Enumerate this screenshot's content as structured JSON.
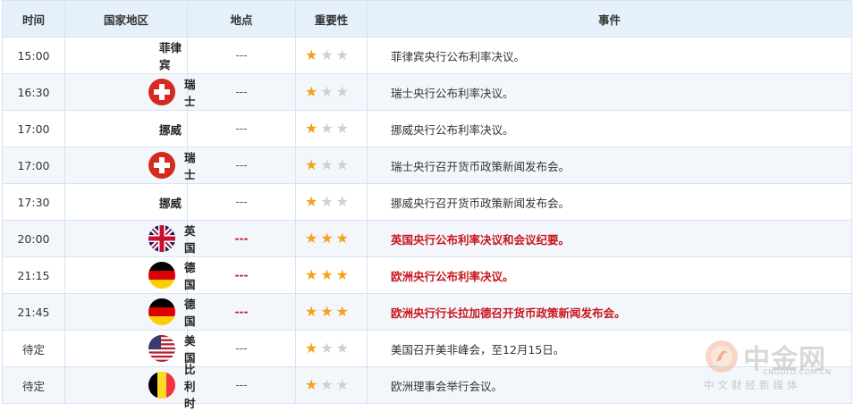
{
  "header": {
    "time": "时间",
    "country": "国家地区",
    "location": "地点",
    "importance": "重要性",
    "event": "事件"
  },
  "rows": [
    {
      "time": "15:00",
      "flag": "none",
      "country": "菲律宾",
      "location": "---",
      "stars": 1,
      "event": "菲律宾央行公布利率决议。",
      "highlight": false
    },
    {
      "time": "16:30",
      "flag": "switzerland",
      "country": "瑞士",
      "location": "---",
      "stars": 1,
      "event": "瑞士央行公布利率决议。",
      "highlight": false
    },
    {
      "time": "17:00",
      "flag": "none",
      "country": "挪威",
      "location": "---",
      "stars": 1,
      "event": "挪威央行公布利率决议。",
      "highlight": false
    },
    {
      "time": "17:00",
      "flag": "switzerland",
      "country": "瑞士",
      "location": "---",
      "stars": 1,
      "event": "瑞士央行召开货币政策新闻发布会。",
      "highlight": false
    },
    {
      "time": "17:30",
      "flag": "none",
      "country": "挪威",
      "location": "---",
      "stars": 1,
      "event": "挪威央行召开货币政策新闻发布会。",
      "highlight": false
    },
    {
      "time": "20:00",
      "flag": "uk",
      "country": "英国",
      "location": "---",
      "stars": 3,
      "event": "英国央行公布利率决议和会议纪要。",
      "highlight": true
    },
    {
      "time": "21:15",
      "flag": "germany",
      "country": "德国",
      "location": "---",
      "stars": 3,
      "event": "欧洲央行公布利率决议。",
      "highlight": true
    },
    {
      "time": "21:45",
      "flag": "germany",
      "country": "德国",
      "location": "---",
      "stars": 3,
      "event": "欧洲央行行长拉加德召开货币政策新闻发布会。",
      "highlight": true
    },
    {
      "time": "待定",
      "flag": "usa",
      "country": "美国",
      "location": "---",
      "stars": 1,
      "event": "美国召开美非峰会，至12月15日。",
      "highlight": false
    },
    {
      "time": "待定",
      "flag": "belgium",
      "country": "比利时",
      "location": "---",
      "stars": 1,
      "event": "欧洲理事会举行会议。",
      "highlight": false
    }
  ],
  "max_stars": 3,
  "colors": {
    "header_bg": "#e6f0fb",
    "border": "#d5e3f2",
    "alt_row": "#f3f7fc",
    "highlight_text": "#c8161d",
    "star_on": "#f4a21a",
    "star_off": "#cfcfcf"
  },
  "watermark": {
    "brand": "中金网",
    "url": "CNGOLD.COM.CN",
    "tagline": "中文财经新媒体"
  }
}
